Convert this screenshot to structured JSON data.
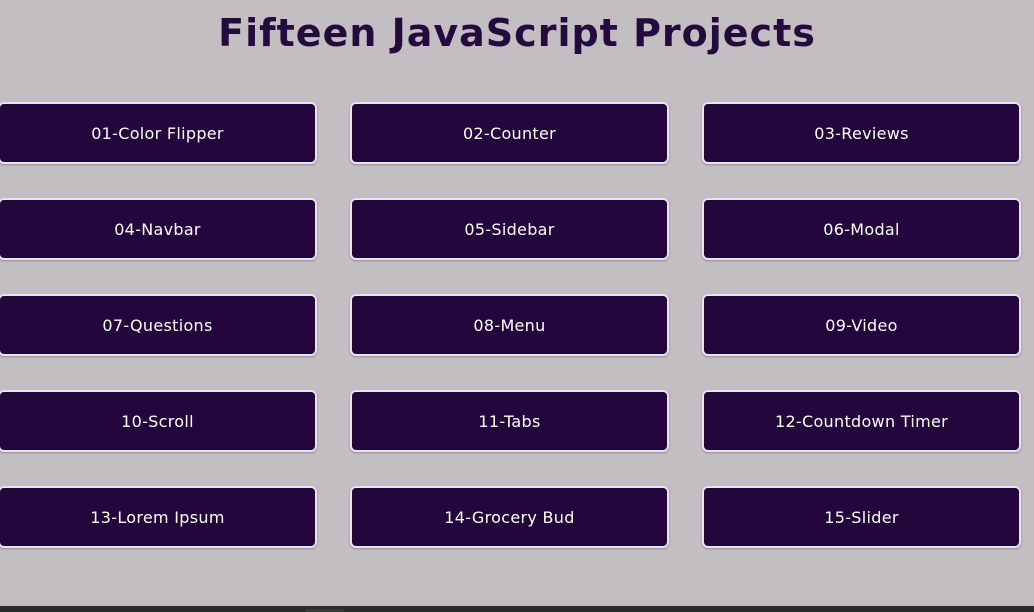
{
  "header": {
    "title": "Fifteen JavaScript Projects"
  },
  "projects": [
    {
      "label": "01-Color Flipper"
    },
    {
      "label": "02-Counter"
    },
    {
      "label": "03-Reviews"
    },
    {
      "label": "04-Navbar"
    },
    {
      "label": "05-Sidebar"
    },
    {
      "label": "06-Modal"
    },
    {
      "label": "07-Questions"
    },
    {
      "label": "08-Menu"
    },
    {
      "label": "09-Video"
    },
    {
      "label": "10-Scroll"
    },
    {
      "label": "11-Tabs"
    },
    {
      "label": "12-Countdown Timer"
    },
    {
      "label": "13-Lorem Ipsum"
    },
    {
      "label": "14-Grocery Bud"
    },
    {
      "label": "15-Slider"
    }
  ],
  "colors": {
    "background": "#c2bec2",
    "title": "#240b3d",
    "button_bg": "#23073c",
    "button_text": "#ffffff",
    "button_border": "#e8e4ea"
  }
}
